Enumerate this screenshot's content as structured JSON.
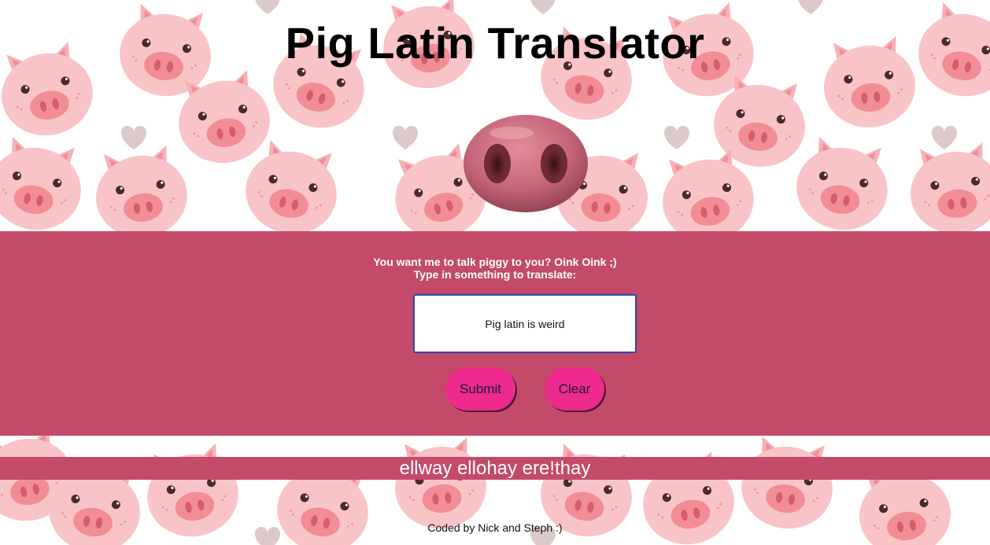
{
  "page": {
    "title": "Pig Latin Translator"
  },
  "prompt": {
    "line1": "You want me to talk piggy to you? Oink Oink ;)",
    "line2": "Type in something to translate:"
  },
  "input": {
    "value": "Pig latin is weird"
  },
  "buttons": {
    "submit_label": "Submit",
    "clear_label": "Clear"
  },
  "output": {
    "text": "ellway ellohay ere!thay"
  },
  "footer": {
    "credit": "Coded by Nick and Steph :)"
  },
  "colors": {
    "band": "#c44a6a",
    "button": "#ee2a8e",
    "pig_face": "#f7b8bb",
    "snout": "#c46478"
  },
  "icons": {
    "background": "pig-face-pattern",
    "hero": "pig-nose-icon"
  }
}
